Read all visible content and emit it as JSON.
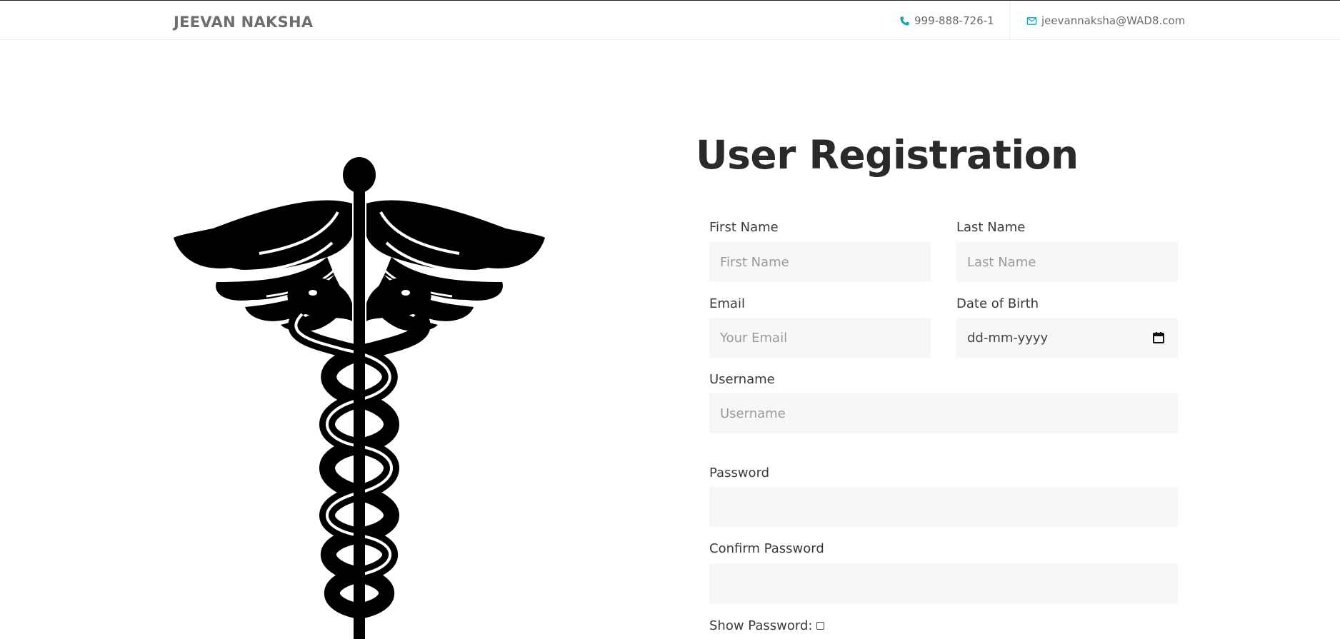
{
  "header": {
    "brand": "JEEVAN NAKSHA",
    "phone": "999-888-726-1",
    "email": "jeevannaksha@WAD8.com"
  },
  "form": {
    "title": "User Registration",
    "first_name_label": "First Name",
    "first_name_placeholder": "First Name",
    "last_name_label": "Last Name",
    "last_name_placeholder": "Last Name",
    "email_label": "Email",
    "email_placeholder": "Your Email",
    "dob_label": "Date of Birth",
    "dob_placeholder": "dd-mm-yyyy",
    "username_label": "Username",
    "username_placeholder": "Username",
    "password_label": "Password",
    "confirm_password_label": "Confirm Password",
    "show_password_label": "Show Password:"
  },
  "icons": {
    "phone": "phone-icon",
    "email": "envelope-icon",
    "calendar": "calendar-icon",
    "logo": "caduceus-icon"
  },
  "colors": {
    "accent": "#1aa3b0",
    "field_bg": "#f7f7f7"
  }
}
